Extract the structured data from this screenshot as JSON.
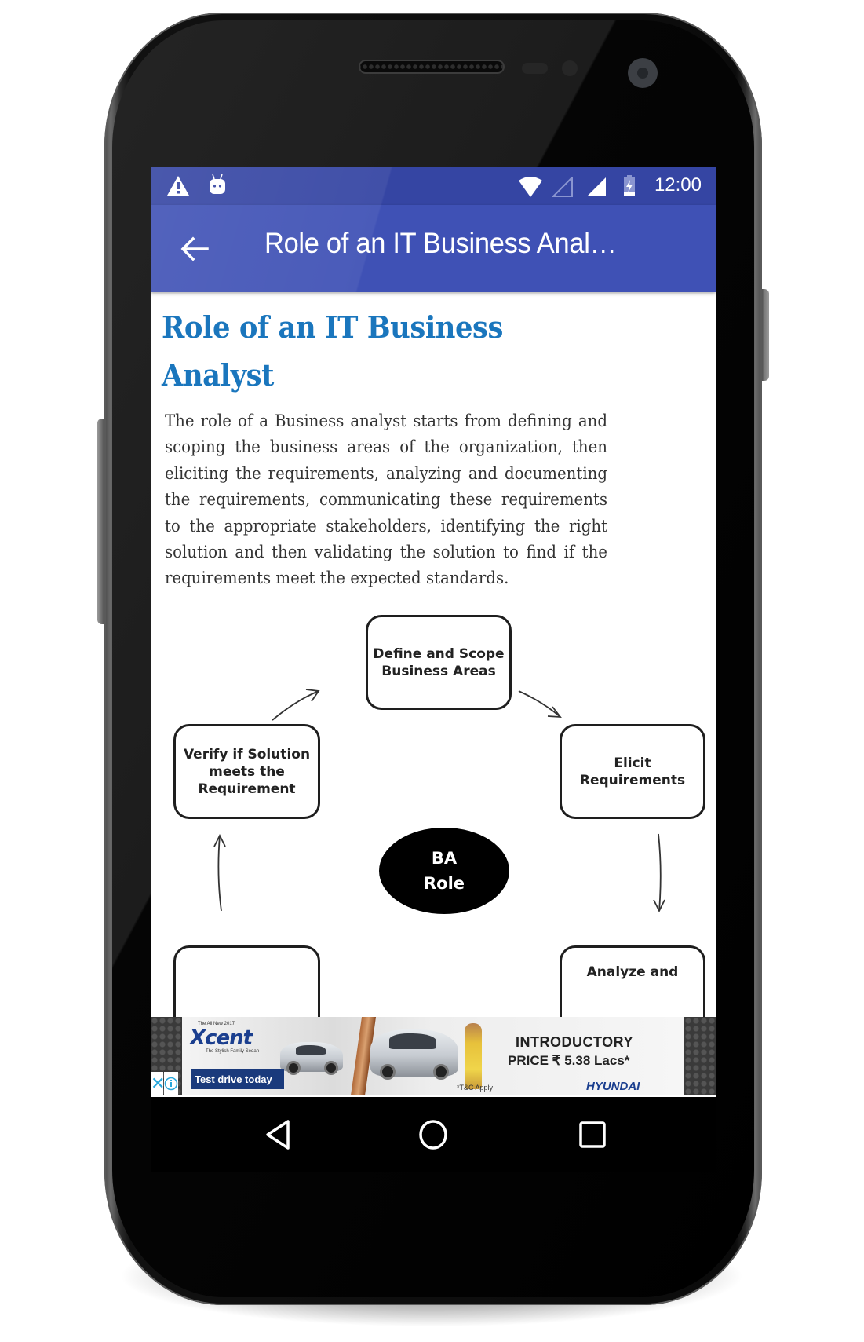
{
  "device": {
    "status_bar": {
      "left_icons": [
        "warning-icon",
        "android-debug-icon"
      ],
      "right_icons": [
        "wifi-icon",
        "signal-empty-icon",
        "signal-full-icon",
        "battery-charging-icon"
      ],
      "time": "12:00"
    },
    "nav_bar": {
      "buttons": [
        {
          "name": "back",
          "icon": "triangle-back-icon"
        },
        {
          "name": "home",
          "icon": "circle-home-icon"
        },
        {
          "name": "recents",
          "icon": "square-recents-icon"
        }
      ]
    }
  },
  "app_bar": {
    "back_icon": "arrow-left-icon",
    "title": "Role of an IT Business Anal…"
  },
  "article": {
    "heading": "Role of an IT Business Analyst",
    "paragraph": "The role of a Business analyst starts from defining and scoping the business areas of the organization, then eliciting the requirements, analyzing and documenting the requirements, communicating these requirements to the appropriate stakeholders, identifying the right solution and then validating the solution to find if the requirements meet the expected standards."
  },
  "diagram": {
    "center": "BA\nRole",
    "center_lines": [
      "BA",
      "Role"
    ],
    "boxes": {
      "top": "Define and Scope\nBusiness Areas",
      "top_lines": [
        "Define and Scope",
        "Business Areas"
      ],
      "right": "Elicit\nRequirements",
      "right_lines": [
        "Elicit",
        "Requirements"
      ],
      "left": "Verify if Solution\nmeets the\nRequirement",
      "left_lines": [
        "Verify if Solution",
        "meets the",
        "Requirement"
      ],
      "bottom_right_partial": "Analyze and",
      "bottom_left_partial": ""
    }
  },
  "ad": {
    "brand_small": "The All New 2017",
    "model": "Xcent",
    "tagline": "The Stylish Family Sedan",
    "headline": "INTRODUCTORY",
    "price": "PRICE ₹ 5.38 Lacs*",
    "cta": "Test drive today",
    "terms": "*T&C Apply",
    "maker": "HYUNDAI",
    "close_label": "✕",
    "info_icon": "info-icon"
  },
  "colors": {
    "status_bar": "#3545a3",
    "app_bar": "#3f51b5",
    "heading": "#1a76bd",
    "body_text": "#333333"
  }
}
